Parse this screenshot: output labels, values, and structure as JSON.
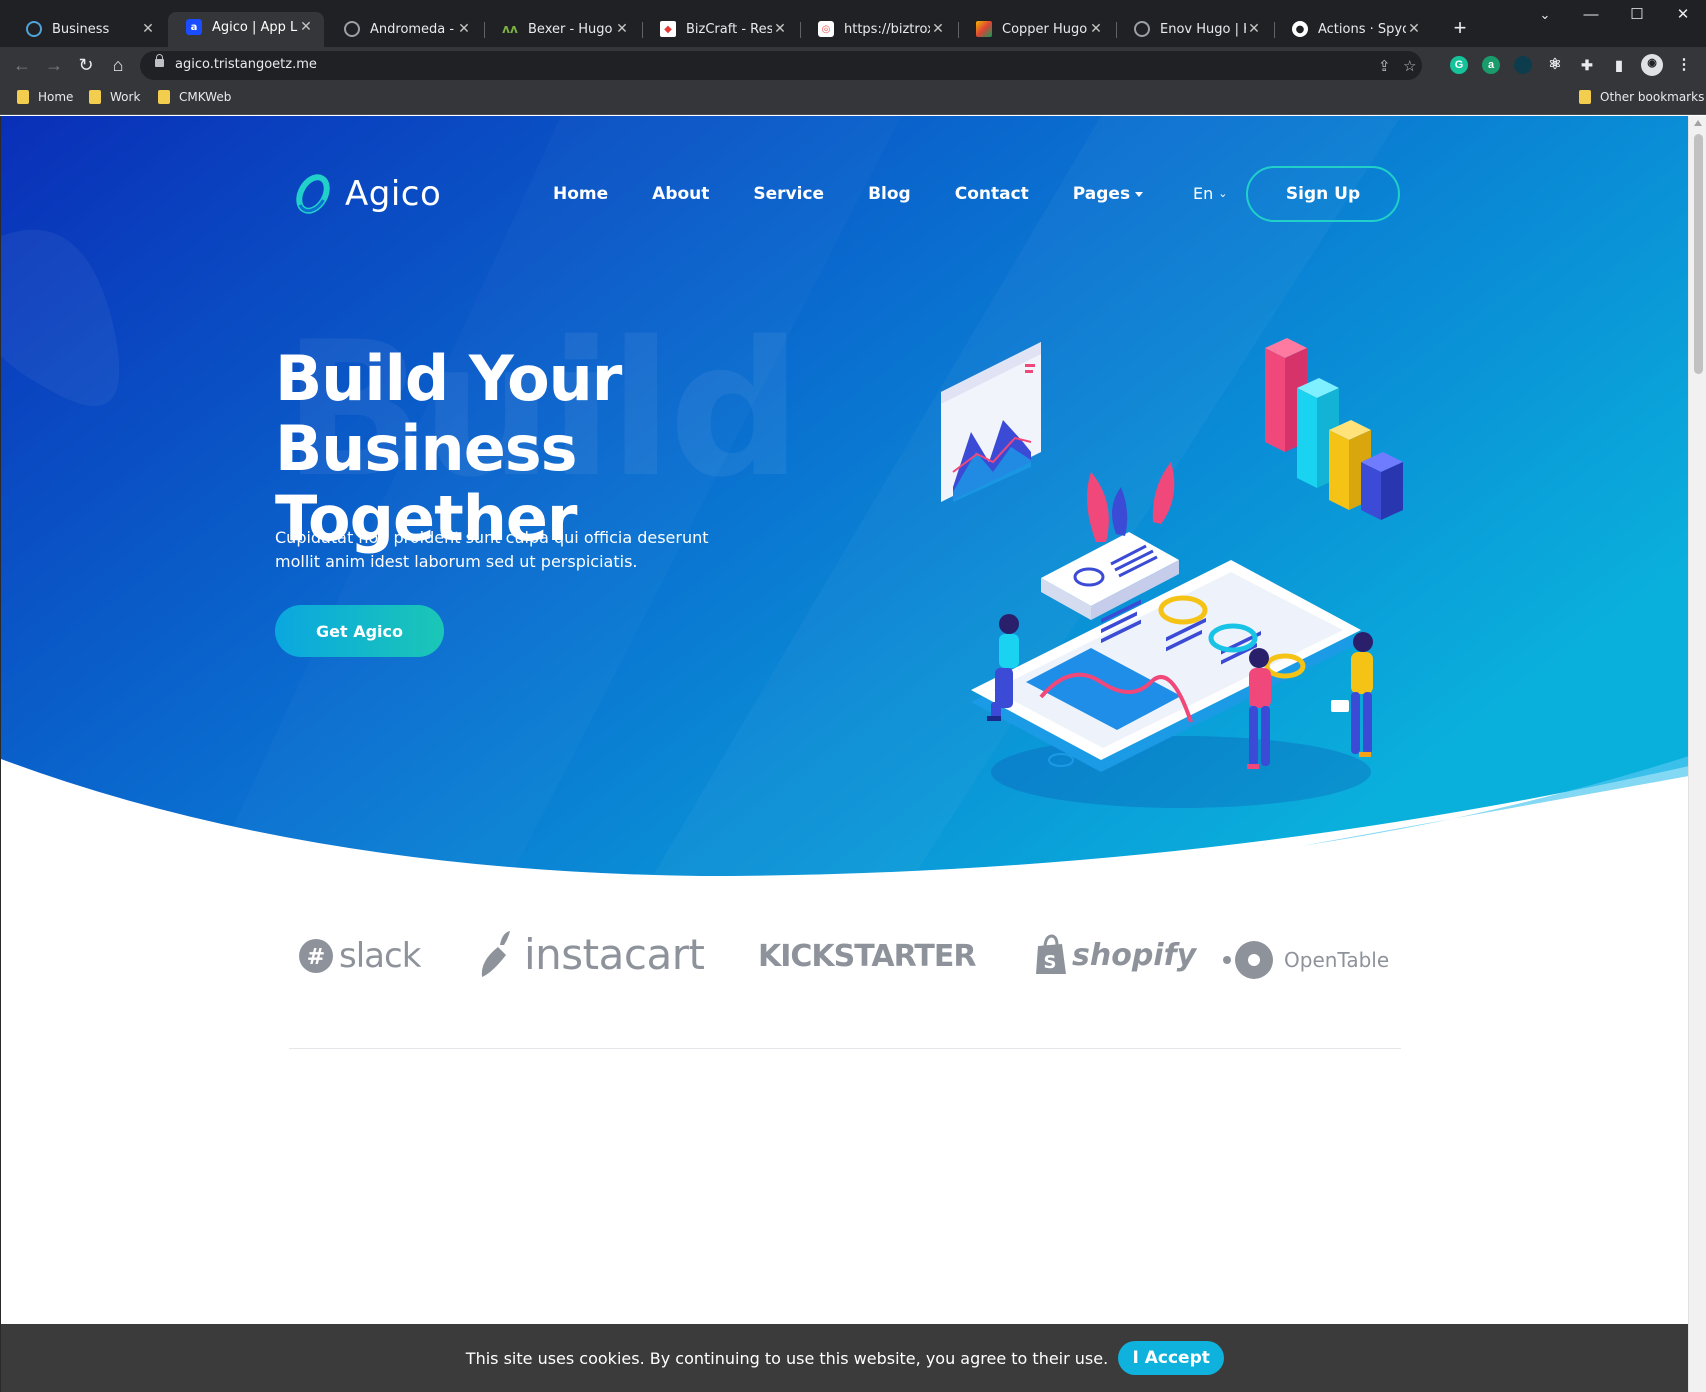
{
  "browser": {
    "tabs": [
      {
        "title": "Business",
        "favicon_color": "#4fa3d9",
        "active": false
      },
      {
        "title": "Agico | App Landi",
        "favicon_color": "#1a4dff",
        "active": true
      },
      {
        "title": "Andromeda - Soft",
        "favicon_color": "#9aa0a6",
        "active": false
      },
      {
        "title": "Bexer - Hugo Busi",
        "favicon_color": "#7cb342",
        "active": false
      },
      {
        "title": "BizCraft - Respon",
        "favicon_color": "#e53935",
        "active": false
      },
      {
        "title": "https://biztrox.tris",
        "favicon_color": "#ef5350",
        "active": false
      },
      {
        "title": "Copper Hugo - Sc",
        "favicon_color": "#f4b400",
        "active": false
      },
      {
        "title": "Enov Hugo | Html",
        "favicon_color": "#9aa0a6",
        "active": false
      },
      {
        "title": "Actions · SpyderH",
        "favicon_color": "#ffffff",
        "active": false
      }
    ],
    "url": "agico.tristangoetz.me",
    "bookmarks": [
      {
        "label": "Home"
      },
      {
        "label": "Work"
      },
      {
        "label": "CMKWeb"
      }
    ],
    "other_bookmarks": "Other bookmarks",
    "icons": {
      "back": "arrow-left-icon",
      "forward": "arrow-right-icon",
      "reload": "reload-icon",
      "home": "home-icon",
      "share": "share-icon",
      "bookmark_star": "star-icon",
      "menu": "kebab-menu-icon"
    }
  },
  "site": {
    "logo_text": "Agico",
    "nav": [
      {
        "label": "Home"
      },
      {
        "label": "About"
      },
      {
        "label": "Service"
      },
      {
        "label": "Blog"
      },
      {
        "label": "Contact"
      },
      {
        "label": "Pages",
        "dropdown": true
      }
    ],
    "language": "En",
    "signup_label": "Sign Up",
    "ghost_word": "Build",
    "headline_line1": "Build Your",
    "headline_line2": "Business Together",
    "subtitle": "Cupidatat non proident sunt culpa qui officia deserunt mollit anim idest laborum sed ut perspiciatis.",
    "cta_label": "Get Agico",
    "brands": [
      {
        "name": "slack"
      },
      {
        "name": "instacart"
      },
      {
        "name": "KICKSTARTER"
      },
      {
        "name": "shopify"
      },
      {
        "name": "OpenTable"
      }
    ],
    "colors": {
      "hero_start": "#0a2fb8",
      "hero_end": "#0ab0dc",
      "accent": "#21d0c9",
      "brand_gray": "#8e939b"
    }
  },
  "cookie": {
    "message": "This site uses cookies. By continuing to use this website, you agree to their use.",
    "accept_label": "I Accept"
  }
}
